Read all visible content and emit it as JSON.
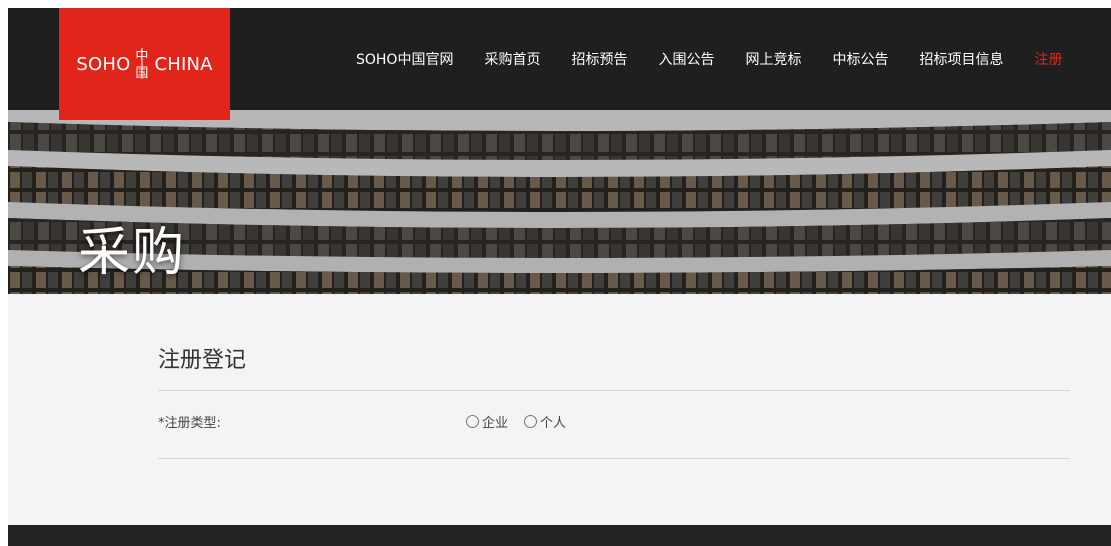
{
  "header": {
    "logo": {
      "left": "SOHO",
      "mark": "中国",
      "right": "CHINA"
    },
    "nav": [
      {
        "label": "SOHO中国官网"
      },
      {
        "label": "采购首页"
      },
      {
        "label": "招标预告"
      },
      {
        "label": "入围公告"
      },
      {
        "label": "网上竞标"
      },
      {
        "label": "中标公告"
      },
      {
        "label": "招标项目信息"
      },
      {
        "label": "注册",
        "active": true
      }
    ]
  },
  "banner": {
    "title": "采购"
  },
  "form": {
    "title": "注册登记",
    "registration_type": {
      "label": "*注册类型:",
      "options": [
        {
          "label": "企业"
        },
        {
          "label": "个人"
        }
      ]
    }
  },
  "colors": {
    "accent": "#e1251b",
    "header_bg": "#1f1f1f",
    "content_bg": "#f4f4f4",
    "footer_bg": "#222222"
  }
}
